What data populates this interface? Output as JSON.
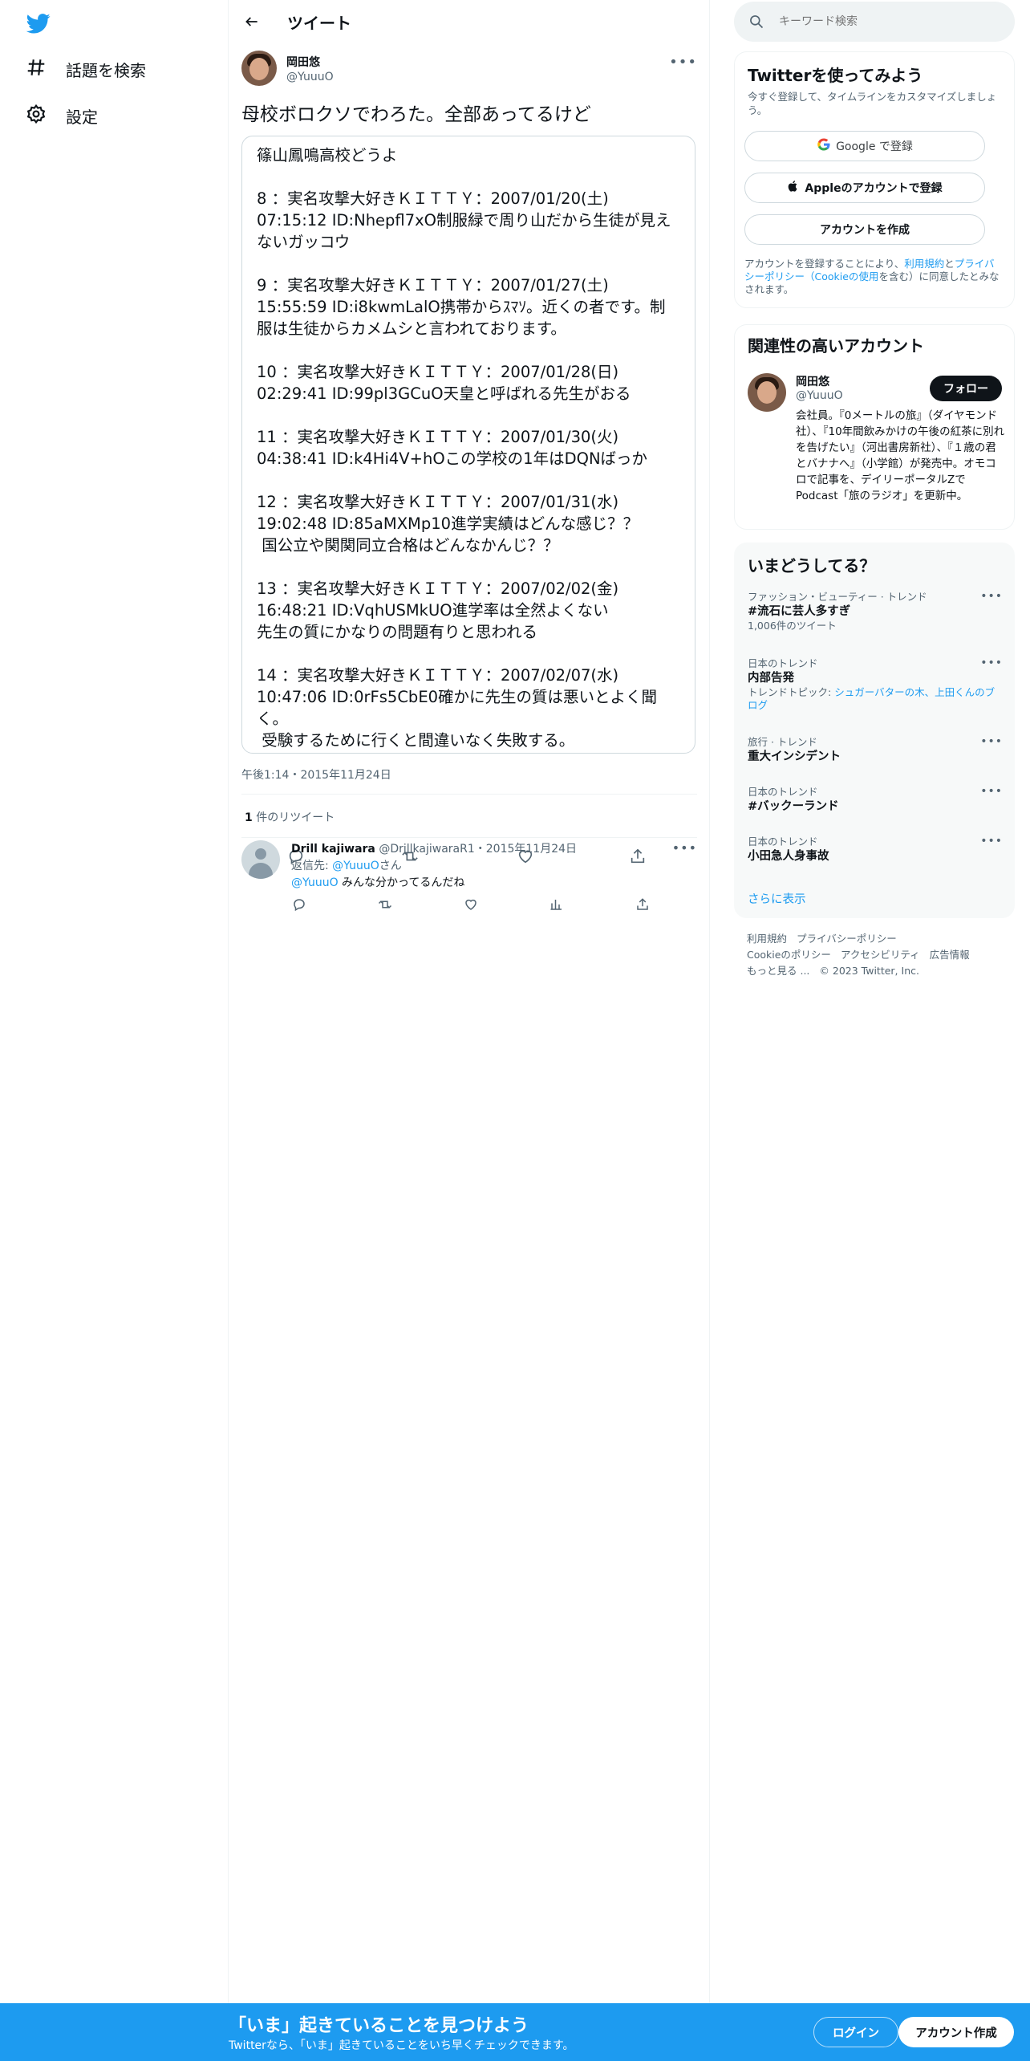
{
  "nav": {
    "logo": "twitter-bird",
    "items": [
      {
        "label": "話題を検索",
        "icon": "hashtag-icon"
      },
      {
        "label": "設定",
        "icon": "gear-icon"
      }
    ]
  },
  "header": {
    "title": "ツイート"
  },
  "tweet": {
    "author_name": "岡田悠",
    "author_handle": "@YuuuO",
    "text": "母校ボロクソでわろた。全部あってるけど",
    "quote_lines": [
      "篠山鳳鳴高校どうよ",
      "",
      "8 ：実名攻撃大好きＫＩＴＴＹ：2007/01/20(土)",
      "07:15:12 ID:Nhepfl7xO制服緑で周り山だから生徒が見え",
      "ないガッコウ",
      "",
      "9 ：実名攻撃大好きＫＩＴＴＹ：2007/01/27(土)",
      "15:55:59 ID:i8kwmLalO携帯からｽﾏｿ。近くの者です。制",
      "服は生徒からカメムシと言われております。",
      "",
      "10 ：実名攻撃大好きＫＩＴＴＹ：2007/01/28(日)",
      "02:29:41 ID:99pl3GCuO天皇と呼ばれる先生がおる",
      "",
      "11 ：実名攻撃大好きＫＩＴＴＹ：2007/01/30(火)",
      "04:38:41 ID:k4Hi4V+hOこの学校の1年はDQNばっか",
      "",
      "12 ：実名攻撃大好きＫＩＴＴＹ：2007/01/31(水)",
      "19:02:48 ID:85aMXMp10進学実績はどんな感じ？？",
      " 国公立や関関同立合格はどんなかんじ？？",
      "",
      "13 ：実名攻撃大好きＫＩＴＴＹ：2007/02/02(金)",
      "16:48:21 ID:VqhUSMkUO進学率は全然よくない",
      "先生の質にかなりの問題有りと思われる",
      "",
      "14 ：実名攻撃大好きＫＩＴＴＹ：2007/02/07(水)",
      "10:47:06 ID:0rFs5CbE0確かに先生の質は悪いとよく聞",
      "く。",
      " 受験するために行くと間違いなく失敗する。"
    ],
    "timestamp": "午後1:14・2015年11月24日",
    "retweet_count": "1",
    "retweet_label": " 件のリツイート"
  },
  "reply": {
    "name": "Drill kajiwara",
    "meta": " @DrillkajiwaraR1・2015年11月24日",
    "replying_to_label": "返信先: ",
    "replying_to_handle": "@YuuuO",
    "replying_to_suffix": "さん",
    "mention": "@YuuuO",
    "text": " みんな分かってるんだね"
  },
  "search": {
    "placeholder": "キーワード検索"
  },
  "signup_card": {
    "title": "Twitterを使ってみよう",
    "subtitle": "今すぐ登録して、タイムラインをカスタマイズしましょう。",
    "google_label": "Google で登録",
    "apple_label": "Appleのアカウントで登録",
    "create_label": "アカウントを作成",
    "terms_prefix": "アカウントを登録することにより、",
    "terms_link1": "利用規約",
    "terms_and": "と",
    "terms_link2": "プライバシーポリシー（Cookieの使用",
    "terms_suffix": "を含む）に同意したとみなされます。"
  },
  "related": {
    "title": "関連性の高いアカウント",
    "name": "岡田悠",
    "handle": "@YuuuO",
    "follow_label": "フォロー",
    "bio": "会社員。『0メートルの旅』（ダイヤモンド社）、『10年間飲みかけの午後の紅茶に別れを告げたい』（河出書房新社）、『１歳の君とバナナへ』（小学館）が発売中。オモコロで記事を、デイリーポータルZでPodcast「旅のラジオ」を更新中。"
  },
  "trends": {
    "title": "いまどうしてる？",
    "items": [
      {
        "meta": "ファッション・ビューティー · トレンド",
        "name": "#流石に芸人多すぎ",
        "extra": "1,006件のツイート"
      },
      {
        "meta": "日本のトレンド",
        "name": "内部告発",
        "extra_prefix": "トレンドトピック: ",
        "extra_link": "シュガーバターの木、上田くんのブログ"
      },
      {
        "meta": "旅行 · トレンド",
        "name": "重大インシデント"
      },
      {
        "meta": "日本のトレンド",
        "name": "#バックーランド"
      },
      {
        "meta": "日本のトレンド",
        "name": "小田急人身事故"
      }
    ],
    "show_more": "さらに表示"
  },
  "footer": {
    "links": [
      "利用規約",
      "プライバシーポリシー",
      "Cookieのポリシー",
      "アクセシビリティ",
      "広告情報",
      "もっと見る ..."
    ],
    "copyright": "© 2023 Twitter, Inc."
  },
  "bottom_bar": {
    "title": "「いま」起きていることを見つけよう",
    "subtitle": "Twitterなら、「いま」起きていることをいち早くチェックできます。",
    "login_label": "ログイン",
    "signup_label": "アカウント作成"
  },
  "colors": {
    "accent": "#1d9bf0",
    "text": "#0f1419",
    "muted": "#536471"
  }
}
